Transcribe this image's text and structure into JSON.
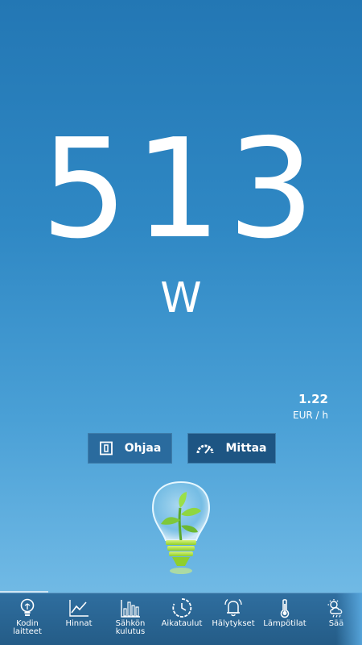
{
  "power": {
    "value": "513",
    "unit": "W"
  },
  "price": {
    "value": "1.22",
    "unit": "EUR / h"
  },
  "buttons": {
    "ohjaa_label": "Ohjaa",
    "mittaa_label": "Mittaa"
  },
  "tabs": [
    {
      "label": "Kodin\nlaitteet",
      "icon": "bulb-icon"
    },
    {
      "label": "Hinnat",
      "icon": "line-chart-icon"
    },
    {
      "label": "Sähkön\nkulutus",
      "icon": "bar-chart-icon"
    },
    {
      "label": "Aikataulut",
      "icon": "clock-icon"
    },
    {
      "label": "Hälytykset",
      "icon": "bell-icon"
    },
    {
      "label": "Lämpötilat",
      "icon": "thermometer-icon"
    },
    {
      "label": "Sää",
      "icon": "weather-icon"
    }
  ],
  "colors": {
    "background_top": "#2377b4",
    "background_bottom": "#7cc1e8",
    "tabbar": "#245c87",
    "button_ohjaa": "#2a6b9e",
    "button_mittaa": "#1d5583",
    "leaf_green": "#7ec83a"
  }
}
